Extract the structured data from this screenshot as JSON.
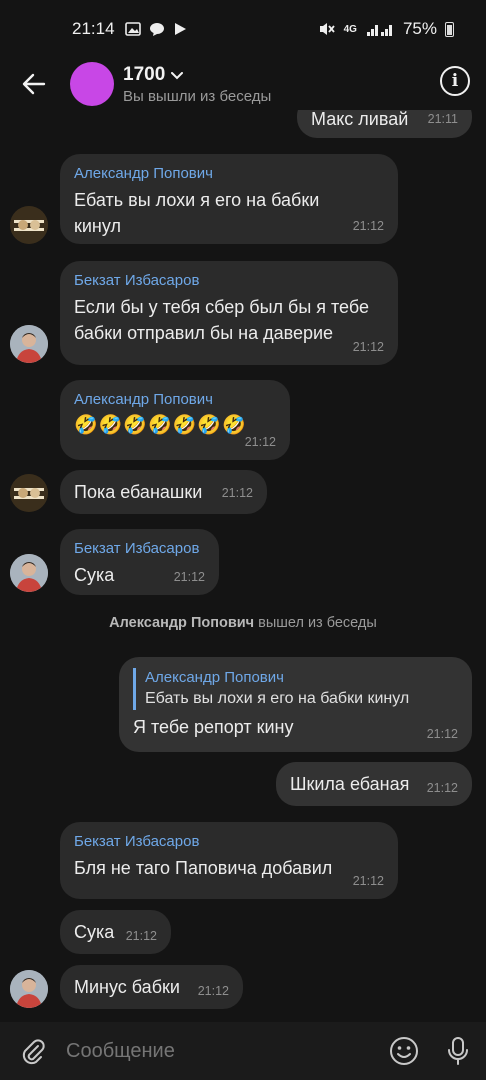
{
  "status_bar": {
    "time": "21:14",
    "network": "4G",
    "battery": "75%",
    "icons": [
      "image-icon",
      "chat-bubble-icon",
      "play-icon",
      "mute-icon",
      "signal-icon",
      "battery-icon"
    ]
  },
  "header": {
    "title": "1700",
    "subtitle": "Вы вышли из беседы",
    "avatar_color": "#c847e6"
  },
  "messages": [
    {
      "id": "m0",
      "direction": "out",
      "text": "Макс ливай",
      "time": "21:11"
    },
    {
      "id": "m1",
      "direction": "in",
      "sender": "Александр Попович",
      "text": "Ебать вы лохи я его на бабки\nкинул",
      "time": "21:12"
    },
    {
      "id": "m2",
      "direction": "in",
      "sender": "Бекзат Избасаров",
      "text": "Если бы у тебя сбер был бы я тебе\nбабки отправил бы на даверие",
      "time": "21:12"
    },
    {
      "id": "m3",
      "direction": "in",
      "sender": "Александр Попович",
      "text": "🤣🤣🤣🤣🤣🤣🤣",
      "time": "21:12"
    },
    {
      "id": "m4",
      "direction": "in",
      "text": "Пока ебанашки",
      "time": "21:12"
    },
    {
      "id": "m5",
      "direction": "in",
      "sender": "Бекзат Избасаров",
      "text": "Сука",
      "time": "21:12"
    },
    {
      "id": "m7",
      "direction": "out",
      "reply_to": {
        "sender": "Александр Попович",
        "text": "Ебать вы лохи я его на бабки кинул"
      },
      "text": "Я тебе репорт кину",
      "time": "21:12"
    },
    {
      "id": "m8",
      "direction": "out",
      "text": "Шкила ебаная",
      "time": "21:12"
    },
    {
      "id": "m9",
      "direction": "in",
      "sender": "Бекзат Избасаров",
      "text": "Бля не таго Паповича добавил",
      "time": "21:12"
    },
    {
      "id": "m10",
      "direction": "in",
      "text": "Сука",
      "time": "21:12"
    },
    {
      "id": "m11",
      "direction": "in",
      "text": "Минус бабки",
      "time": "21:12"
    }
  ],
  "system_message": {
    "actor": "Александр Попович",
    "action": "вышел из беседы"
  },
  "composer": {
    "placeholder": "Сообщение"
  },
  "colors": {
    "background": "#141414",
    "bubble_in": "#2b2b2b",
    "bubble_out": "#333333",
    "sender_name": "#6fa8e8",
    "accent_avatar": "#c847e6"
  }
}
